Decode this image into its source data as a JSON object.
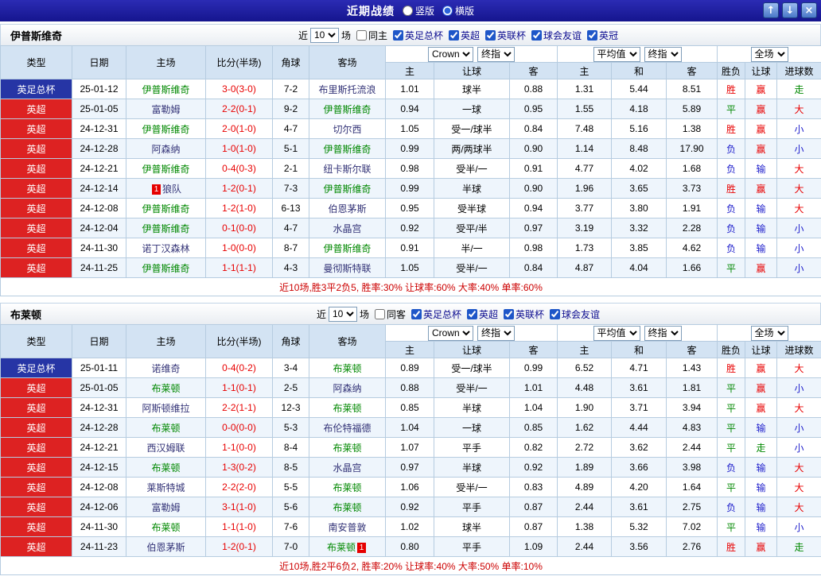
{
  "titlebar": {
    "title": "近期战绩",
    "layout_options": [
      {
        "label": "竖版",
        "checked": false
      },
      {
        "label": "横版",
        "checked": true
      }
    ],
    "buttons": {
      "up": "↑",
      "down": "↓",
      "close": "×"
    }
  },
  "table_head": {
    "columns": [
      "类型",
      "日期",
      "主场",
      "比分(半场)",
      "角球",
      "客场"
    ],
    "odds_selects": {
      "book": "Crown",
      "ref": "终指"
    },
    "avg_selects": {
      "label": "平均值",
      "ref": "终指"
    },
    "scope_select": "全场",
    "odds_sub": [
      "主",
      "让球",
      "客"
    ],
    "avg_sub": [
      "主",
      "和",
      "客"
    ],
    "result_sub": [
      "胜负",
      "让球",
      "进球数"
    ]
  },
  "palette": {
    "league_colors": {
      "英足总杯": "#2635a5",
      "英超": "#dd2222"
    },
    "result_colors": {
      "win": "#e80000",
      "draw": "#008800",
      "loss": "#2020cc"
    },
    "result_class_map": {
      "胜": "win",
      "平": "draw",
      "负": "loss",
      "赢": "win",
      "输": "loss",
      "走": "draw",
      "大": "win",
      "小": "loss"
    }
  },
  "sections": [
    {
      "team": "伊普斯维奇",
      "filter": {
        "near_label": "近",
        "count": "10",
        "games_label": "场",
        "same": {
          "label": "同主",
          "checked": false
        },
        "leagues": [
          {
            "label": "英足总杯",
            "checked": true
          },
          {
            "label": "英超",
            "checked": true
          },
          {
            "label": "英联杯",
            "checked": true
          },
          {
            "label": "球会友谊",
            "checked": true
          },
          {
            "label": "英冠",
            "checked": true
          }
        ]
      },
      "rows": [
        {
          "league": "英足总杯",
          "date": "25-01-12",
          "home": {
            "name": "伊普斯维奇",
            "focal": true
          },
          "score": "3-0(3-0)",
          "corner": "7-2",
          "away": {
            "name": "布里斯托流浪",
            "focal": false
          },
          "odds": [
            "1.01",
            "球半",
            "0.88"
          ],
          "avg": [
            "1.31",
            "5.44",
            "8.51"
          ],
          "results": [
            "胜",
            "赢",
            "走"
          ]
        },
        {
          "league": "英超",
          "date": "25-01-05",
          "home": {
            "name": "富勒姆",
            "focal": false
          },
          "score": "2-2(0-1)",
          "corner": "9-2",
          "away": {
            "name": "伊普斯维奇",
            "focal": true
          },
          "odds": [
            "0.94",
            "一球",
            "0.95"
          ],
          "avg": [
            "1.55",
            "4.18",
            "5.89"
          ],
          "results": [
            "平",
            "赢",
            "大"
          ]
        },
        {
          "league": "英超",
          "date": "24-12-31",
          "home": {
            "name": "伊普斯维奇",
            "focal": true
          },
          "score": "2-0(1-0)",
          "corner": "4-7",
          "away": {
            "name": "切尔西",
            "focal": false
          },
          "odds": [
            "1.05",
            "受一/球半",
            "0.84"
          ],
          "avg": [
            "7.48",
            "5.16",
            "1.38"
          ],
          "results": [
            "胜",
            "赢",
            "小"
          ]
        },
        {
          "league": "英超",
          "date": "24-12-28",
          "home": {
            "name": "阿森纳",
            "focal": false
          },
          "score": "1-0(1-0)",
          "corner": "5-1",
          "away": {
            "name": "伊普斯维奇",
            "focal": true
          },
          "odds": [
            "0.99",
            "两/两球半",
            "0.90"
          ],
          "avg": [
            "1.14",
            "8.48",
            "17.90"
          ],
          "results": [
            "负",
            "赢",
            "小"
          ]
        },
        {
          "league": "英超",
          "date": "24-12-21",
          "home": {
            "name": "伊普斯维奇",
            "focal": true
          },
          "score": "0-4(0-3)",
          "corner": "2-1",
          "away": {
            "name": "纽卡斯尔联",
            "focal": false
          },
          "odds": [
            "0.98",
            "受半/一",
            "0.91"
          ],
          "avg": [
            "4.77",
            "4.02",
            "1.68"
          ],
          "results": [
            "负",
            "输",
            "大"
          ]
        },
        {
          "league": "英超",
          "date": "24-12-14",
          "home": {
            "name": "狼队",
            "focal": false,
            "card_before": "1"
          },
          "score": "1-2(0-1)",
          "corner": "7-3",
          "away": {
            "name": "伊普斯维奇",
            "focal": true
          },
          "odds": [
            "0.99",
            "半球",
            "0.90"
          ],
          "avg": [
            "1.96",
            "3.65",
            "3.73"
          ],
          "results": [
            "胜",
            "赢",
            "大"
          ]
        },
        {
          "league": "英超",
          "date": "24-12-08",
          "home": {
            "name": "伊普斯维奇",
            "focal": true
          },
          "score": "1-2(1-0)",
          "corner": "6-13",
          "away": {
            "name": "伯恩茅斯",
            "focal": false
          },
          "odds": [
            "0.95",
            "受半球",
            "0.94"
          ],
          "avg": [
            "3.77",
            "3.80",
            "1.91"
          ],
          "results": [
            "负",
            "输",
            "大"
          ]
        },
        {
          "league": "英超",
          "date": "24-12-04",
          "home": {
            "name": "伊普斯维奇",
            "focal": true
          },
          "score": "0-1(0-0)",
          "corner": "4-7",
          "away": {
            "name": "水晶宫",
            "focal": false
          },
          "odds": [
            "0.92",
            "受平/半",
            "0.97"
          ],
          "avg": [
            "3.19",
            "3.32",
            "2.28"
          ],
          "results": [
            "负",
            "输",
            "小"
          ]
        },
        {
          "league": "英超",
          "date": "24-11-30",
          "home": {
            "name": "诺丁汉森林",
            "focal": false
          },
          "score": "1-0(0-0)",
          "corner": "8-7",
          "away": {
            "name": "伊普斯维奇",
            "focal": true
          },
          "odds": [
            "0.91",
            "半/一",
            "0.98"
          ],
          "avg": [
            "1.73",
            "3.85",
            "4.62"
          ],
          "results": [
            "负",
            "输",
            "小"
          ]
        },
        {
          "league": "英超",
          "date": "24-11-25",
          "home": {
            "name": "伊普斯维奇",
            "focal": true
          },
          "score": "1-1(1-1)",
          "corner": "4-3",
          "away": {
            "name": "曼彻斯特联",
            "focal": false
          },
          "odds": [
            "1.05",
            "受半/一",
            "0.84"
          ],
          "avg": [
            "4.87",
            "4.04",
            "1.66"
          ],
          "results": [
            "平",
            "赢",
            "小"
          ]
        }
      ],
      "summary": "近10场,胜3平2负5, 胜率:30% 让球率:60% 大率:40% 单率:60%"
    },
    {
      "team": "布莱顿",
      "filter": {
        "near_label": "近",
        "count": "10",
        "games_label": "场",
        "same": {
          "label": "同客",
          "checked": false
        },
        "leagues": [
          {
            "label": "英足总杯",
            "checked": true
          },
          {
            "label": "英超",
            "checked": true
          },
          {
            "label": "英联杯",
            "checked": true
          },
          {
            "label": "球会友谊",
            "checked": true
          }
        ]
      },
      "rows": [
        {
          "league": "英足总杯",
          "date": "25-01-11",
          "home": {
            "name": "诺维奇",
            "focal": false
          },
          "score": "0-4(0-2)",
          "corner": "3-4",
          "away": {
            "name": "布莱顿",
            "focal": true
          },
          "odds": [
            "0.89",
            "受一/球半",
            "0.99"
          ],
          "avg": [
            "6.52",
            "4.71",
            "1.43"
          ],
          "results": [
            "胜",
            "赢",
            "大"
          ]
        },
        {
          "league": "英超",
          "date": "25-01-05",
          "home": {
            "name": "布莱顿",
            "focal": true
          },
          "score": "1-1(0-1)",
          "corner": "2-5",
          "away": {
            "name": "阿森纳",
            "focal": false
          },
          "odds": [
            "0.88",
            "受半/一",
            "1.01"
          ],
          "avg": [
            "4.48",
            "3.61",
            "1.81"
          ],
          "results": [
            "平",
            "赢",
            "小"
          ]
        },
        {
          "league": "英超",
          "date": "24-12-31",
          "home": {
            "name": "阿斯顿维拉",
            "focal": false
          },
          "score": "2-2(1-1)",
          "corner": "12-3",
          "away": {
            "name": "布莱顿",
            "focal": true
          },
          "odds": [
            "0.85",
            "半球",
            "1.04"
          ],
          "avg": [
            "1.90",
            "3.71",
            "3.94"
          ],
          "results": [
            "平",
            "赢",
            "大"
          ]
        },
        {
          "league": "英超",
          "date": "24-12-28",
          "home": {
            "name": "布莱顿",
            "focal": true
          },
          "score": "0-0(0-0)",
          "corner": "5-3",
          "away": {
            "name": "布伦特福德",
            "focal": false
          },
          "odds": [
            "1.04",
            "一球",
            "0.85"
          ],
          "avg": [
            "1.62",
            "4.44",
            "4.83"
          ],
          "results": [
            "平",
            "输",
            "小"
          ]
        },
        {
          "league": "英超",
          "date": "24-12-21",
          "home": {
            "name": "西汉姆联",
            "focal": false
          },
          "score": "1-1(0-0)",
          "corner": "8-4",
          "away": {
            "name": "布莱顿",
            "focal": true
          },
          "odds": [
            "1.07",
            "平手",
            "0.82"
          ],
          "avg": [
            "2.72",
            "3.62",
            "2.44"
          ],
          "results": [
            "平",
            "走",
            "小"
          ]
        },
        {
          "league": "英超",
          "date": "24-12-15",
          "home": {
            "name": "布莱顿",
            "focal": true
          },
          "score": "1-3(0-2)",
          "corner": "8-5",
          "away": {
            "name": "水晶宫",
            "focal": false
          },
          "odds": [
            "0.97",
            "半球",
            "0.92"
          ],
          "avg": [
            "1.89",
            "3.66",
            "3.98"
          ],
          "results": [
            "负",
            "输",
            "大"
          ]
        },
        {
          "league": "英超",
          "date": "24-12-08",
          "home": {
            "name": "莱斯特城",
            "focal": false
          },
          "score": "2-2(2-0)",
          "corner": "5-5",
          "away": {
            "name": "布莱顿",
            "focal": true
          },
          "odds": [
            "1.06",
            "受半/一",
            "0.83"
          ],
          "avg": [
            "4.89",
            "4.20",
            "1.64"
          ],
          "results": [
            "平",
            "输",
            "大"
          ]
        },
        {
          "league": "英超",
          "date": "24-12-06",
          "home": {
            "name": "富勒姆",
            "focal": false
          },
          "score": "3-1(1-0)",
          "corner": "5-6",
          "away": {
            "name": "布莱顿",
            "focal": true
          },
          "odds": [
            "0.92",
            "平手",
            "0.87"
          ],
          "avg": [
            "2.44",
            "3.61",
            "2.75"
          ],
          "results": [
            "负",
            "输",
            "大"
          ]
        },
        {
          "league": "英超",
          "date": "24-11-30",
          "home": {
            "name": "布莱顿",
            "focal": true
          },
          "score": "1-1(1-0)",
          "corner": "7-6",
          "away": {
            "name": "南安普敦",
            "focal": false
          },
          "odds": [
            "1.02",
            "球半",
            "0.87"
          ],
          "avg": [
            "1.38",
            "5.32",
            "7.02"
          ],
          "results": [
            "平",
            "输",
            "小"
          ]
        },
        {
          "league": "英超",
          "date": "24-11-23",
          "home": {
            "name": "伯恩茅斯",
            "focal": false
          },
          "score": "1-2(0-1)",
          "corner": "7-0",
          "away": {
            "name": "布莱顿",
            "focal": true,
            "card_after": "1"
          },
          "odds": [
            "0.80",
            "平手",
            "1.09"
          ],
          "avg": [
            "2.44",
            "3.56",
            "2.76"
          ],
          "results": [
            "胜",
            "赢",
            "走"
          ]
        }
      ],
      "summary": "近10场,胜2平6负2, 胜率:20% 让球率:40% 大率:50% 单率:10%"
    }
  ]
}
